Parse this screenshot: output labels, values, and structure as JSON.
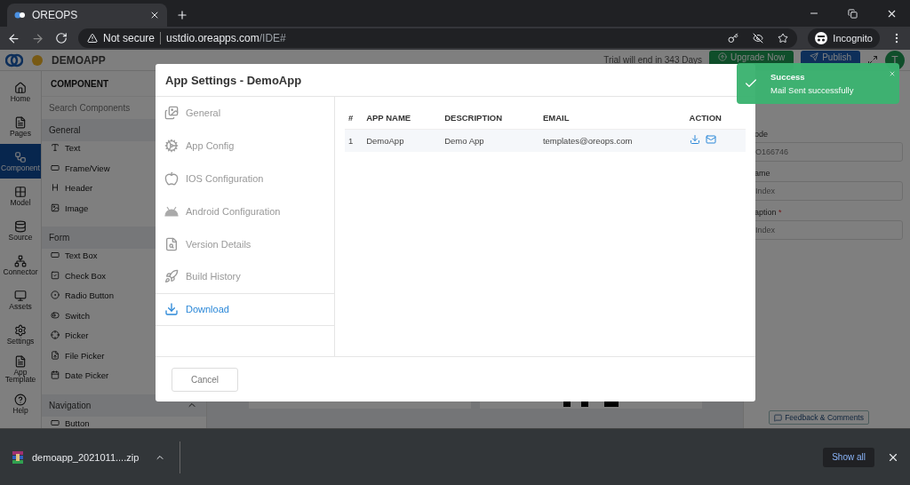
{
  "browser": {
    "tab_title": "OREOPS",
    "security": "Not secure",
    "host": "ustdio.oreapps.com",
    "path": "/IDE#",
    "profile": "Incognito"
  },
  "app": {
    "name": "DEMOAPP",
    "trial": "Trial will end in 343 Days",
    "upgrade": "Upgrade Now",
    "publish": "Publish",
    "avatar": "T"
  },
  "rail": [
    {
      "label": "Home",
      "selected": false
    },
    {
      "label": "Pages",
      "selected": false
    },
    {
      "label": "Component",
      "selected": true
    },
    {
      "label": "Model",
      "selected": false
    },
    {
      "label": "Source",
      "selected": false
    },
    {
      "label": "Connector",
      "selected": false
    },
    {
      "label": "Assets",
      "selected": false
    },
    {
      "label": "Settings",
      "selected": false
    },
    {
      "label": "App Template",
      "selected": false
    },
    {
      "label": "Help",
      "selected": false
    }
  ],
  "component_panel": {
    "title": "COMPONENT",
    "search_placeholder": "Search Components",
    "groups": [
      {
        "title": "General",
        "items": [
          "Text",
          "Frame/View",
          "Header",
          "Image"
        ]
      },
      {
        "title": "Form",
        "items": [
          "Text Box",
          "Check Box",
          "Radio Button",
          "Switch",
          "Picker",
          "File Picker",
          "Date Picker"
        ]
      },
      {
        "title": "Navigation",
        "items": [
          "Button"
        ]
      }
    ]
  },
  "properties": [
    {
      "label": "ode",
      "value": "O166746"
    },
    {
      "label": "ame",
      "value": "Index"
    },
    {
      "label": "aption",
      "required_mark": "*",
      "value": "Index"
    }
  ],
  "feedback": "Feedback & Comments",
  "modal": {
    "title": "App Settings - DemoApp",
    "nav": [
      {
        "label": "General",
        "selected": false
      },
      {
        "label": "App Config",
        "selected": false
      },
      {
        "label": "IOS Configuration",
        "selected": false
      },
      {
        "label": "Android Configuration",
        "selected": false
      },
      {
        "label": "Version Details",
        "selected": false
      },
      {
        "label": "Build History",
        "selected": false
      },
      {
        "label": "Download",
        "selected": true
      }
    ],
    "columns": [
      "#",
      "APP NAME",
      "DESCRIPTION",
      "EMAIL",
      "ACTION"
    ],
    "rows": [
      {
        "index": "1",
        "app_name": "DemoApp",
        "description": "Demo App",
        "email": "templates@oreops.com"
      }
    ],
    "cancel": "Cancel"
  },
  "toast": {
    "title": "Success",
    "message": "Mail Sent successfully"
  },
  "downloads": {
    "file": "demoapp_2021011....zip",
    "show_all": "Show all"
  }
}
